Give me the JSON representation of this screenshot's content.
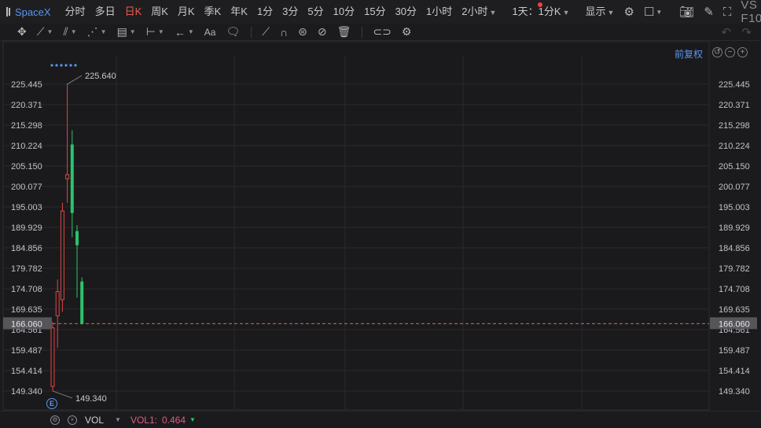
{
  "topbar": {
    "symbol": "SpaceX",
    "timeframes": [
      "分时",
      "多日",
      "日K",
      "周K",
      "月K",
      "季K",
      "年K",
      "1分",
      "3分",
      "5分",
      "10分",
      "15分",
      "30分",
      "1小时",
      "2小时"
    ],
    "active": "日K",
    "period_select": "1天：1分K",
    "display_label": "显示",
    "f10_label": "VS F10"
  },
  "toolbar": {
    "icons": [
      "move-icon",
      "line-icon",
      "channel-icon",
      "wave-icon",
      "fib-icon",
      "measure-icon",
      "arrow-icon",
      "text-icon",
      "note-icon",
      "ruler-icon",
      "magnet-icon",
      "lock-icon",
      "hide-icon",
      "trash-icon",
      "link-icon",
      "settings-icon"
    ]
  },
  "adjust_label": "前复权",
  "axis": {
    "ticks": [
      "225.445",
      "220.371",
      "215.298",
      "210.224",
      "205.150",
      "200.077",
      "195.003",
      "189.929",
      "184.856",
      "179.782",
      "174.708",
      "169.635",
      "164.561",
      "159.487",
      "154.414",
      "149.340"
    ],
    "current_price": "166.060",
    "max_label": "225.640",
    "min_label": "149.340"
  },
  "chart_data": {
    "type": "candlestick",
    "ylim": [
      149.34,
      225.445
    ],
    "candles": [
      {
        "open": 165.0,
        "high": 166.5,
        "low": 149.34,
        "close": 150.5,
        "dir": "up"
      },
      {
        "open": 174.0,
        "high": 177.0,
        "low": 160.0,
        "close": 168.0,
        "dir": "up"
      },
      {
        "open": 172.0,
        "high": 196.0,
        "low": 169.0,
        "close": 194.0,
        "dir": "up"
      },
      {
        "open": 202.0,
        "high": 225.64,
        "low": 196.0,
        "close": 203.0,
        "dir": "up"
      },
      {
        "open": 210.5,
        "high": 214.0,
        "low": 187.5,
        "close": 193.5,
        "dir": "down"
      },
      {
        "open": 189.0,
        "high": 190.5,
        "low": 172.5,
        "close": 185.5,
        "dir": "down"
      },
      {
        "open": 176.5,
        "high": 177.5,
        "low": 165.8,
        "close": 166.06,
        "dir": "down"
      }
    ]
  },
  "volume": {
    "name": "VOL",
    "label": "VOL1:",
    "value": "0.464"
  },
  "colors": {
    "up": "#e14646",
    "down": "#2cc26b",
    "accent": "#5a95f0",
    "price_line": "#e46b3a"
  }
}
